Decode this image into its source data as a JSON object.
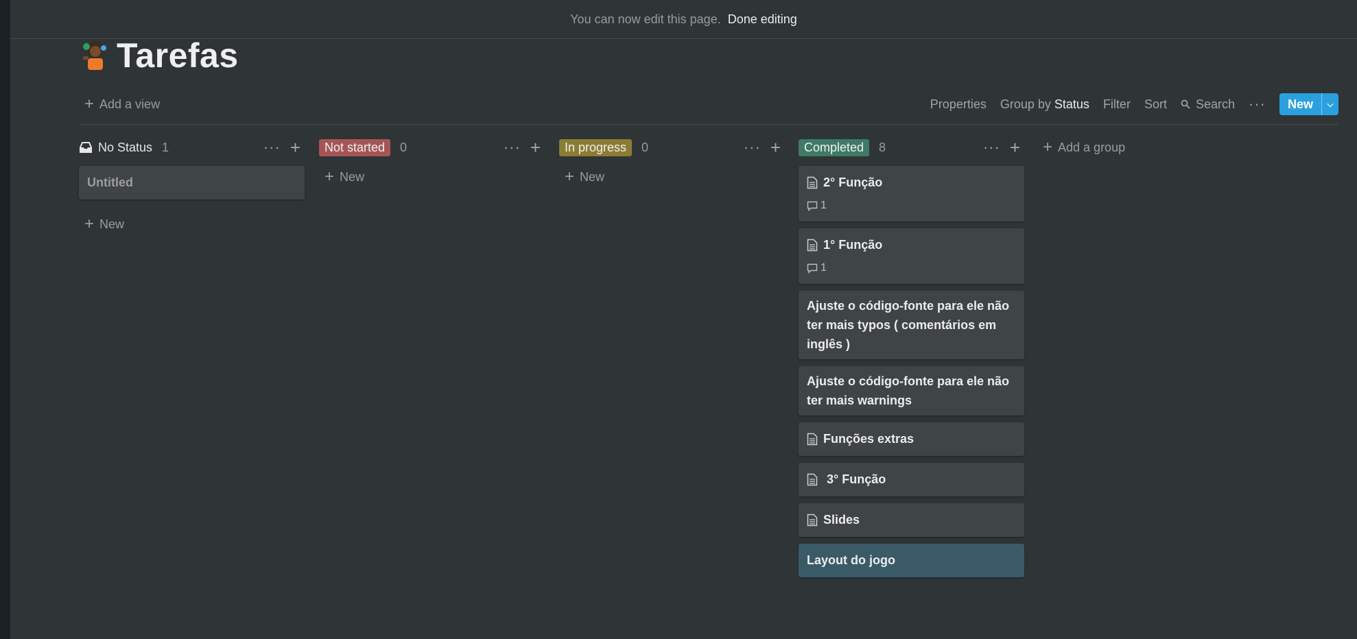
{
  "banner": {
    "message": "You can now edit this page.",
    "action": "Done editing"
  },
  "page": {
    "title": "Tarefas",
    "icon": "person-gesturing-emoji-icon"
  },
  "view_bar": {
    "add_view": "Add a view",
    "properties": "Properties",
    "group_by_prefix": "Group by",
    "group_by_value": "Status",
    "filter": "Filter",
    "sort": "Sort",
    "search": "Search",
    "more": "···",
    "new_button": "New"
  },
  "columns": [
    {
      "name": "No Status",
      "count": "1",
      "badge_color": "",
      "cards": [
        {
          "title": "Untitled"
        }
      ],
      "new_label": "New"
    },
    {
      "name": "Not started",
      "count": "0",
      "badge_color": "#a55555",
      "cards": [],
      "new_label": "New"
    },
    {
      "name": "In progress",
      "count": "0",
      "badge_color": "#8a7d32",
      "cards": [],
      "new_label": "New"
    },
    {
      "name": "Completed",
      "count": "8",
      "badge_color": "#3f7a67",
      "cards": [
        {
          "title": "2° Função",
          "comments": "1"
        },
        {
          "title": "1° Função",
          "comments": "1"
        },
        {
          "title": "Ajuste o código-fonte para ele não ter mais typos ( comentários em inglês )"
        },
        {
          "title": "Ajuste o código-fonte para ele não ter mais warnings"
        },
        {
          "title": "Funções extras"
        },
        {
          "title": " 3° Função"
        },
        {
          "title": "Slides"
        },
        {
          "title": "Layout do jogo"
        }
      ]
    }
  ],
  "add_group": "Add a group"
}
